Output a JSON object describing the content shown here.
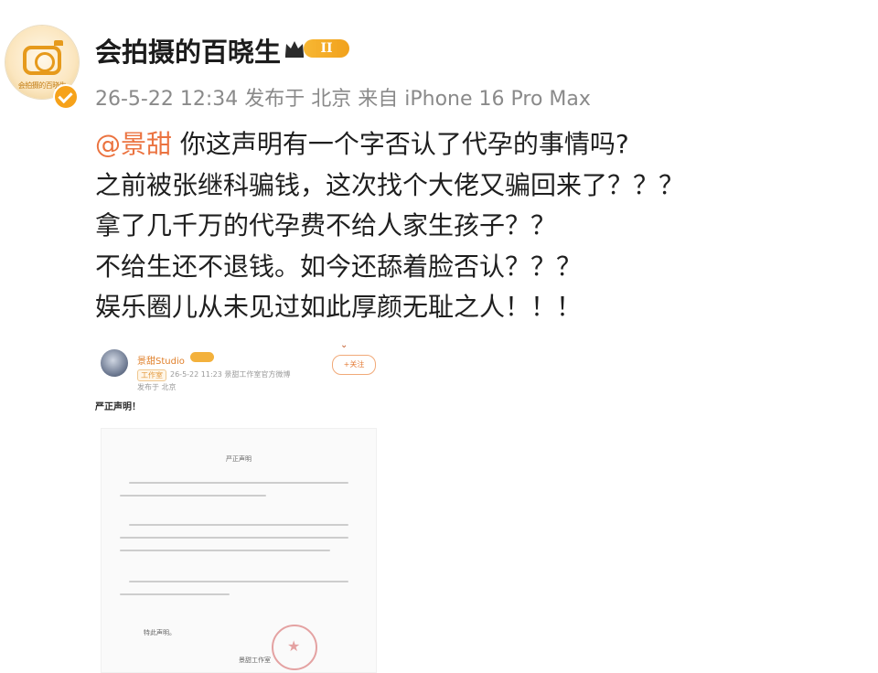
{
  "author": {
    "name": "会拍摄的百晓生",
    "avatar_text": "会拍摄的百晓生",
    "vip_level": "II"
  },
  "meta": {
    "date": "26-5-22",
    "time": "12:34",
    "location": "发布于 北京",
    "device": "来自 iPhone 16 Pro Max"
  },
  "post": {
    "mention": "@景甜",
    "lines": [
      "你这声明有一个字否认了代孕的事情吗?",
      "之前被张继科骗钱，这次找个大佬又骗回来了？？？",
      "拿了几千万的代孕费不给人家生孩子？？",
      "不给生还不退钱。如今还舔着脸否认？？？",
      "娱乐圈儿从未见过如此厚颜无耻之人！！！"
    ]
  },
  "embedded": {
    "account_name": "景甜Studio",
    "tag": "工作室",
    "meta": "26-5-22 11:23 景甜工作室官方微博",
    "location": "发布于 北京",
    "follow_label": "+关注",
    "more_icon": "chevron-down-icon",
    "title": "严正声明！",
    "doc_title": "严正声明",
    "doc_sign": "特此声明。",
    "doc_org": "景甜工作室"
  },
  "colors": {
    "accent": "#eb7340",
    "meta_gray": "#8a8a8a",
    "vip_gold": "#f1a11c"
  }
}
